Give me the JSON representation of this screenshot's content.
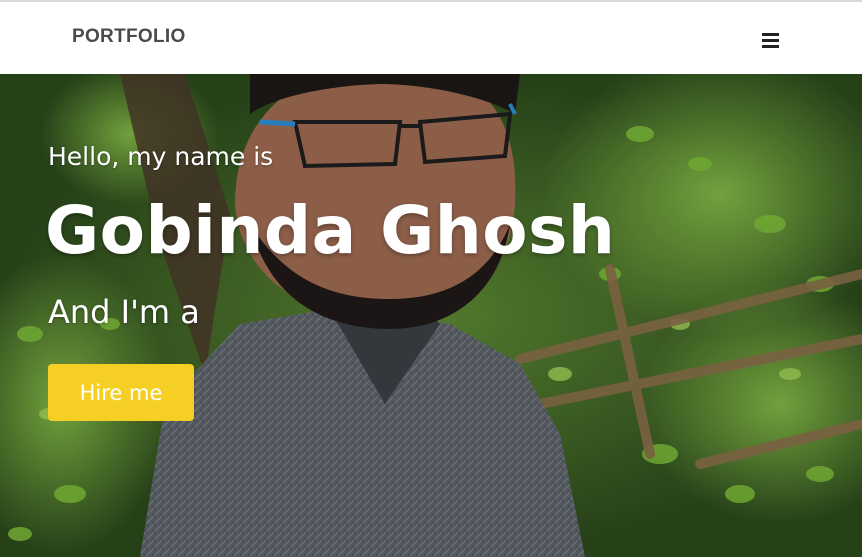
{
  "navbar": {
    "brand": "PORTFOLIO",
    "menu_icon": "hamburger-menu-icon"
  },
  "hero": {
    "greeting": "Hello, my name is",
    "name": "Gobinda Ghosh",
    "role_prefix": "And I'm a",
    "hire_button": "Hire me",
    "background_image": "portrait-photo-in-foliage"
  },
  "colors": {
    "accent": "#f5cf23",
    "nav_text": "#4a4a4a",
    "hero_text": "#ffffff"
  }
}
